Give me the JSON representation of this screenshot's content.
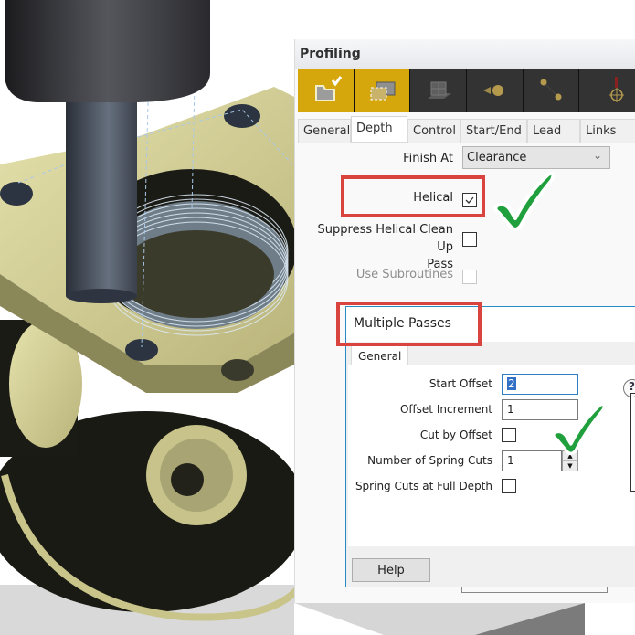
{
  "dialog": {
    "title": "Profiling",
    "strip_icons": [
      {
        "name": "profile-shape-icon",
        "state": "active-checked"
      },
      {
        "name": "boundary-selection-icon",
        "state": "active"
      },
      {
        "name": "stock-model-icon",
        "state": "inactive"
      },
      {
        "name": "tool-icon",
        "state": "inactive"
      },
      {
        "name": "toolpath-points-icon",
        "state": "inactive"
      },
      {
        "name": "datum-target-icon",
        "state": "inactive"
      }
    ],
    "tabs": [
      {
        "label": "General",
        "active": false
      },
      {
        "label": "Depth",
        "active": true
      },
      {
        "label": "Control",
        "active": false
      },
      {
        "label": "Start/End",
        "active": false
      },
      {
        "label": "Lead",
        "active": false
      },
      {
        "label": "Links",
        "active": false
      }
    ],
    "depth": {
      "finish_at_label": "Finish At",
      "finish_at_value": "Clearance",
      "helical_label": "Helical",
      "helical_checked": true,
      "suppress_label_line1": "Suppress Helical Clean Up",
      "suppress_label_line2": "Pass",
      "suppress_checked": false,
      "subroutines_label": "Use Subroutines",
      "subroutines_checked": false,
      "subroutines_enabled": false
    },
    "multiple_passes": {
      "title": "Multiple Passes",
      "tab_label": "General",
      "start_offset_label": "Start Offset",
      "start_offset_value": "2",
      "offset_increment_label": "Offset Increment",
      "offset_increment_value": "1",
      "cut_by_offset_label": "Cut by Offset",
      "cut_by_offset_checked": false,
      "spring_cuts_label": "Number of Spring Cuts",
      "spring_cuts_value": "1",
      "spring_full_depth_label": "Spring Cuts at Full Depth",
      "spring_full_depth_checked": false,
      "help_icon": "?",
      "help_button": "Help"
    }
  },
  "colors": {
    "accent_gold": "#d6a70d",
    "highlight_red": "#d9443f",
    "check_green": "#1fa03c",
    "part_yellow": "#d8d49a"
  }
}
